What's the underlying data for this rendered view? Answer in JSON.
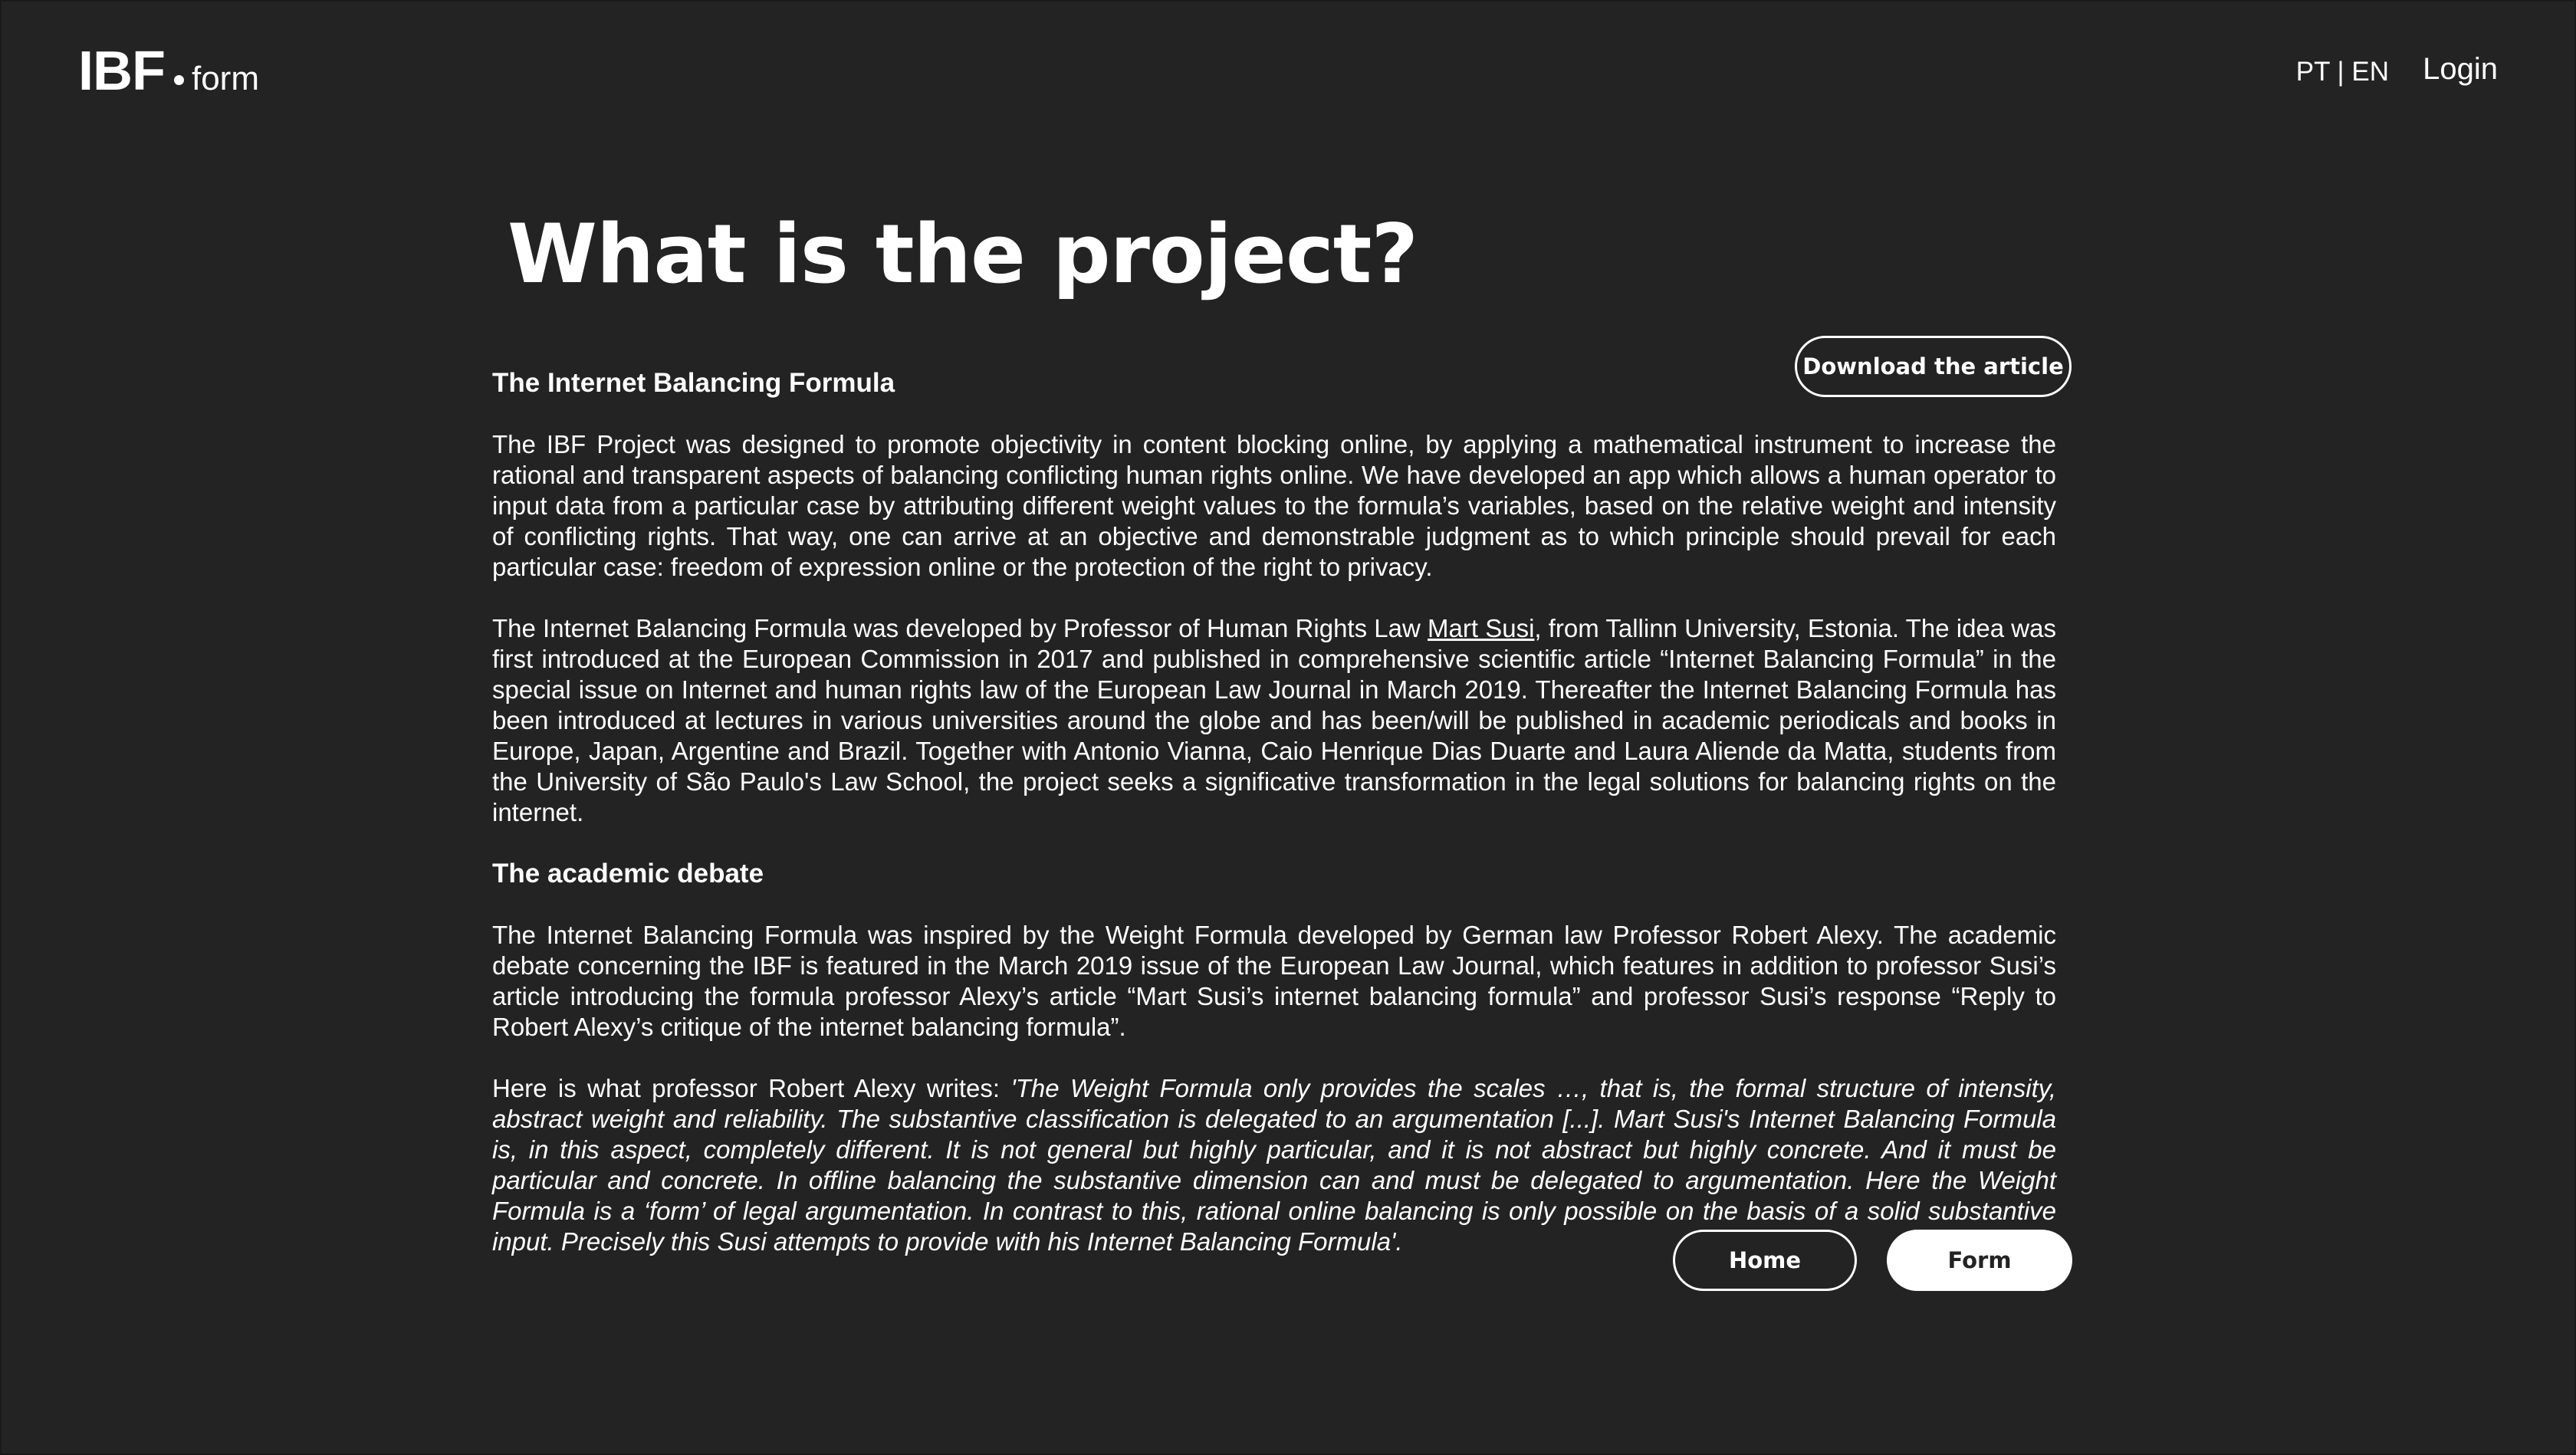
{
  "header": {
    "logo_main": "IBF",
    "logo_sub": "form",
    "lang_switch": "PT | EN",
    "login_label": "Login"
  },
  "main": {
    "title": "What is the project?",
    "download_label": "Download the article",
    "section1_heading": "The Internet Balancing Formula",
    "p1": "The IBF Project was designed to promote objectivity in content blocking online, by applying a mathematical instrument to increase the rational and transparent aspects of balancing conflicting human rights online. We have developed an app which allows a human operator to input data from a particular case by attributing different weight values to the formula’s variables, based on the relative weight and intensity of conflicting rights. That way, one can arrive at an objective and demonstrable judgment as to which principle should prevail for each particular case: freedom of expression online or the protection of the right to privacy.",
    "p2_before_link": "The Internet Balancing Formula was developed by Professor of Human Rights Law ",
    "p2_link": "Mart Susi",
    "p2_after_link": ", from Tallinn University, Estonia. The idea was first introduced at the European Commission in 2017 and published in comprehensive scientific article “Internet Balancing Formula” in the special issue on Internet and human rights law of the European Law Journal in March 2019. Thereafter the Internet Balancing Formula has been introduced at lectures in various universities around the globe and has been/will be published in academic periodicals and books in Europe, Japan, Argentine and Brazil. Together with Antonio Vianna, Caio Henrique Dias Duarte and Laura Aliende da Matta, students from the University of São Paulo's Law School, the project seeks a significative transformation in the legal solutions for balancing rights on the internet.",
    "section2_heading": "The academic debate",
    "p3": "The Internet Balancing Formula was inspired by the Weight Formula developed by German law Professor Robert Alexy. The academic debate concerning the IBF is featured in the March 2019 issue of the European Law Journal, which features in addition to professor Susi’s article introducing the formula professor Alexy’s article “Mart Susi’s internet balancing formula” and professor Susi’s response “Reply to Robert Alexy’s critique of the internet balancing formula”.",
    "p4_intro": "Here is what professor Robert Alexy writes: ",
    "p4_quote": "'The Weight Formula only provides the scales …, that is, the formal structure of intensity, abstract weight and reliability. The substantive classification is delegated to an argumentation [...]. Mart Susi's Internet Balancing Formula is, in this aspect, completely different. It is not general but highly particular, and it is not abstract but highly concrete. And it must be particular and concrete. In offline balancing the substantive dimension can and must be delegated to argumentation. Here the Weight Formula is a ‘form’ of legal argumentation. In contrast to this, rational online balancing is only possible on the basis of a solid substantive input. Precisely this Susi attempts to provide with his Internet Balancing Formula'.",
    "home_label": "Home",
    "form_label": "Form"
  },
  "colors": {
    "background": "#232323",
    "text": "#ffffff"
  }
}
